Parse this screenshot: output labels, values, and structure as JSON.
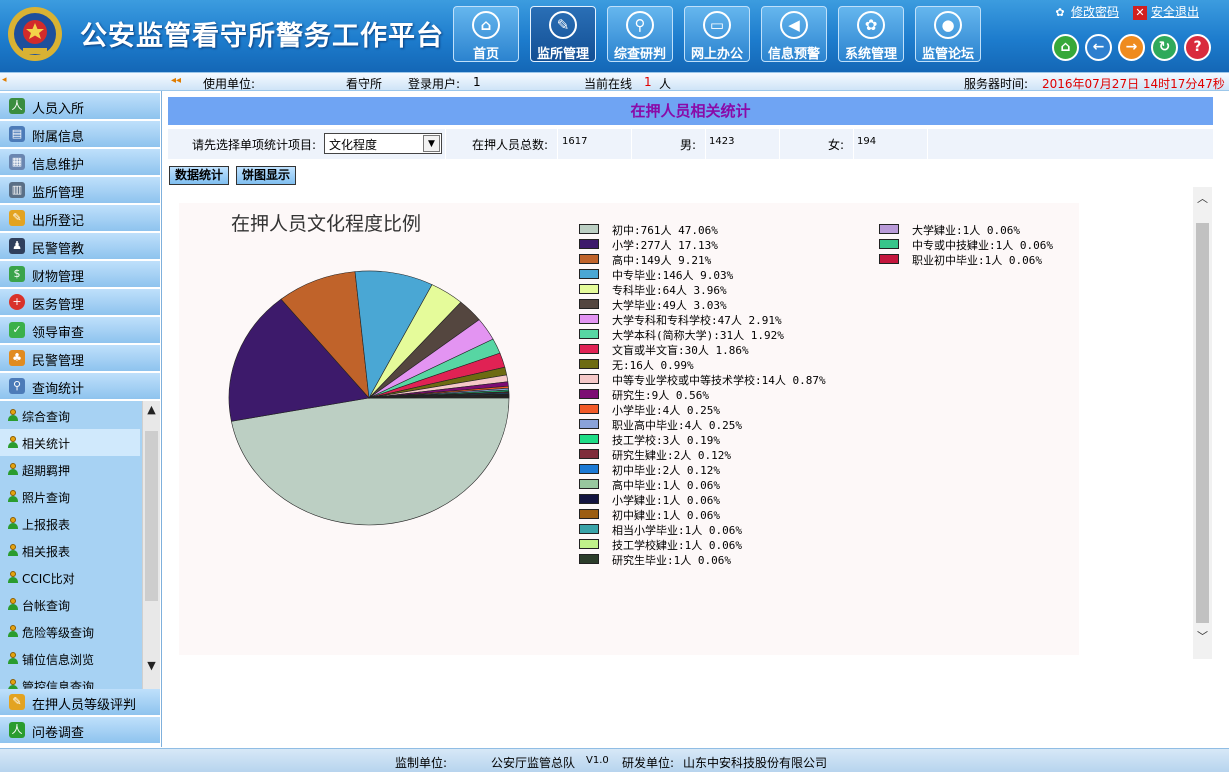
{
  "app": {
    "title": "公安监管看守所警务工作平台",
    "top_links": {
      "change_password": "修改密码",
      "logout": "安全退出"
    }
  },
  "nav": [
    {
      "label": "首页",
      "icon": "home-icon",
      "active": false
    },
    {
      "label": "监所管理",
      "icon": "feather-icon",
      "active": true
    },
    {
      "label": "综查研判",
      "icon": "magnifier-icon",
      "active": false
    },
    {
      "label": "网上办公",
      "icon": "monitor-icon",
      "active": false
    },
    {
      "label": "信息预警",
      "icon": "warning-icon",
      "active": false
    },
    {
      "label": "系统管理",
      "icon": "gear-icon",
      "active": false
    },
    {
      "label": "监管论坛",
      "icon": "forum-icon",
      "active": false
    }
  ],
  "infobar": {
    "unit_label": "使用单位:",
    "unit_value": "看守所",
    "user_label": "登录用户:",
    "user_value": "1",
    "online_label": "当前在线",
    "online_count": "1",
    "online_unit": "人",
    "server_time_label": "服务器时间:",
    "server_time_value": "2016年07月27日 14时17分47秒"
  },
  "sidebar": {
    "menu_top": [
      {
        "label": "人员入所",
        "icon": "person-in-icon"
      },
      {
        "label": "附属信息",
        "icon": "card-icon"
      },
      {
        "label": "信息维护",
        "icon": "database-icon"
      },
      {
        "label": "监所管理",
        "icon": "chart-icon"
      },
      {
        "label": "出所登记",
        "icon": "document-icon"
      },
      {
        "label": "民警管教",
        "icon": "officer-icon"
      },
      {
        "label": "财物管理",
        "icon": "money-icon"
      },
      {
        "label": "医务管理",
        "icon": "medical-icon"
      },
      {
        "label": "领导审查",
        "icon": "check-icon"
      },
      {
        "label": "民警管理",
        "icon": "group-icon"
      },
      {
        "label": "查询统计",
        "icon": "query-icon"
      }
    ],
    "submenu": [
      {
        "label": "综合查询",
        "active": false
      },
      {
        "label": "相关统计",
        "active": true
      },
      {
        "label": "超期羁押",
        "active": false
      },
      {
        "label": "照片查询",
        "active": false
      },
      {
        "label": "上报报表",
        "active": false
      },
      {
        "label": "相关报表",
        "active": false
      },
      {
        "label": "CCIC比对",
        "active": false
      },
      {
        "label": "台帐查询",
        "active": false
      },
      {
        "label": "危险等级查询",
        "active": false
      },
      {
        "label": "铺位信息浏览",
        "active": false
      },
      {
        "label": "管控信息查询",
        "active": false
      }
    ],
    "menu_bottom": [
      {
        "label": "在押人员等级评判",
        "icon": "rating-icon"
      },
      {
        "label": "问卷调查",
        "icon": "survey-icon"
      }
    ]
  },
  "page": {
    "title": "在押人员相关统计",
    "select_label": "请先选择单项统计项目:",
    "select_value": "文化程度",
    "total_label": "在押人员总数:",
    "total_value": "1617",
    "male_label": "男:",
    "male_value": "1423",
    "female_label": "女:",
    "female_value": "194",
    "btn_data": "数据统计",
    "btn_pie": "饼图显示"
  },
  "chart_data": {
    "type": "pie",
    "title": "在押人员文化程度比例",
    "slices": [
      {
        "label": "初中:761人 47.06%",
        "name": "初中",
        "value": 761,
        "percent": 47.06,
        "color": "#bccfc3"
      },
      {
        "label": "小学:277人 17.13%",
        "name": "小学",
        "value": 277,
        "percent": 17.13,
        "color": "#3d1a6b"
      },
      {
        "label": "高中:149人 9.21%",
        "name": "高中",
        "value": 149,
        "percent": 9.21,
        "color": "#c0632a"
      },
      {
        "label": "中专毕业:146人 9.03%",
        "name": "中专毕业",
        "value": 146,
        "percent": 9.03,
        "color": "#4aa7d4"
      },
      {
        "label": "专科毕业:64人 3.96%",
        "name": "专科毕业",
        "value": 64,
        "percent": 3.96,
        "color": "#e5fb9a"
      },
      {
        "label": "大学毕业:49人 3.03%",
        "name": "大学毕业",
        "value": 49,
        "percent": 3.03,
        "color": "#54463f"
      },
      {
        "label": "大学专科和专科学校:47人 2.91%",
        "name": "大学专科和专科学校",
        "value": 47,
        "percent": 2.91,
        "color": "#e394f2"
      },
      {
        "label": "大学本科(简称大学):31人 1.92%",
        "name": "大学本科(简称大学)",
        "value": 31,
        "percent": 1.92,
        "color": "#57d6a3"
      },
      {
        "label": "文盲或半文盲:30人 1.86%",
        "name": "文盲或半文盲",
        "value": 30,
        "percent": 1.86,
        "color": "#e02254"
      },
      {
        "label": "无:16人 0.99%",
        "name": "无",
        "value": 16,
        "percent": 0.99,
        "color": "#6d6b12"
      },
      {
        "label": "中等专业学校或中等技术学校:14人 0.87%",
        "name": "中等专业学校或中等技术学校",
        "value": 14,
        "percent": 0.87,
        "color": "#f5c8c8"
      },
      {
        "label": "研究生:9人 0.56%",
        "name": "研究生",
        "value": 9,
        "percent": 0.56,
        "color": "#7c0d73"
      },
      {
        "label": "小学毕业:4人 0.25%",
        "name": "小学毕业",
        "value": 4,
        "percent": 0.25,
        "color": "#f25a28"
      },
      {
        "label": "职业高中毕业:4人 0.25%",
        "name": "职业高中毕业",
        "value": 4,
        "percent": 0.25,
        "color": "#8aa2d9"
      },
      {
        "label": "技工学校:3人 0.19%",
        "name": "技工学校",
        "value": 3,
        "percent": 0.19,
        "color": "#1fdc86"
      },
      {
        "label": "研究生肄业:2人 0.12%",
        "name": "研究生肄业",
        "value": 2,
        "percent": 0.12,
        "color": "#7f2d3b"
      },
      {
        "label": "初中毕业:2人 0.12%",
        "name": "初中毕业",
        "value": 2,
        "percent": 0.12,
        "color": "#1c79d4"
      },
      {
        "label": "高中毕业:1人 0.06%",
        "name": "高中毕业",
        "value": 1,
        "percent": 0.06,
        "color": "#98c79e"
      },
      {
        "label": "小学肄业:1人 0.06%",
        "name": "小学肄业",
        "value": 1,
        "percent": 0.06,
        "color": "#141440"
      },
      {
        "label": "初中肄业:1人 0.06%",
        "name": "初中肄业",
        "value": 1,
        "percent": 0.06,
        "color": "#9c5e12"
      },
      {
        "label": "相当小学毕业:1人 0.06%",
        "name": "相当小学毕业",
        "value": 1,
        "percent": 0.06,
        "color": "#3aa3a8"
      },
      {
        "label": "技工学校肄业:1人 0.06%",
        "name": "技工学校肄业",
        "value": 1,
        "percent": 0.06,
        "color": "#c0f28a"
      },
      {
        "label": "研究生毕业:1人 0.06%",
        "name": "研究生毕业",
        "value": 1,
        "percent": 0.06,
        "color": "#2c3d2a"
      },
      {
        "label": "大学肄业:1人 0.06%",
        "name": "大学肄业",
        "value": 1,
        "percent": 0.06,
        "color": "#b99ad8"
      },
      {
        "label": "中专或中技肄业:1人 0.06%",
        "name": "中专或中技肄业",
        "value": 1,
        "percent": 0.06,
        "color": "#38c58a"
      },
      {
        "label": "职业初中毕业:1人 0.06%",
        "name": "职业初中毕业",
        "value": 1,
        "percent": 0.06,
        "color": "#c4163d"
      }
    ],
    "legend_position": "right"
  },
  "footer": {
    "supervisor_label": "监制单位:",
    "supervisor_value": "公安厅监管总队",
    "version": "V1.0",
    "developer_label": "研发单位:",
    "developer_value": "山东中安科技股份有限公司"
  }
}
